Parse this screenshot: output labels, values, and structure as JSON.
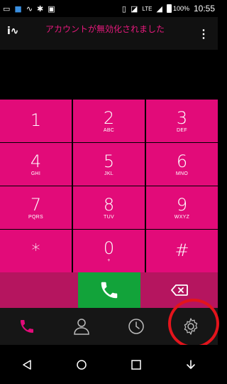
{
  "status_bar": {
    "left_icons": [
      "sim-icon",
      "notification-icon",
      "app-logo-icon",
      "android-icon",
      "photo-icon"
    ],
    "right_icons": [
      "vibrate-icon",
      "nfc-icon",
      "lte-icon",
      "signal-icon",
      "battery-icon"
    ],
    "network": "LTE",
    "battery": "100%",
    "time": "10:55"
  },
  "header": {
    "logo": "i∿",
    "title": "アカウントが無効化されました",
    "menu_label": "⋮"
  },
  "keypad": {
    "keys": [
      {
        "digit": "1",
        "letters": ""
      },
      {
        "digit": "2",
        "letters": "ABC"
      },
      {
        "digit": "3",
        "letters": "DEF"
      },
      {
        "digit": "4",
        "letters": "GHI"
      },
      {
        "digit": "5",
        "letters": "JKL"
      },
      {
        "digit": "6",
        "letters": "MNO"
      },
      {
        "digit": "7",
        "letters": "PQRS"
      },
      {
        "digit": "8",
        "letters": "TUV"
      },
      {
        "digit": "9",
        "letters": "WXYZ"
      },
      {
        "digit": "*",
        "letters": ""
      },
      {
        "digit": "0",
        "letters": "+"
      },
      {
        "digit": "#",
        "letters": ""
      }
    ]
  },
  "actions": {
    "call_icon": "phone-icon",
    "backspace_icon": "backspace-icon"
  },
  "tabs": [
    {
      "name": "dialer",
      "icon": "phone-icon",
      "active": true
    },
    {
      "name": "contacts",
      "icon": "person-icon",
      "active": false
    },
    {
      "name": "history",
      "icon": "clock-icon",
      "active": false
    },
    {
      "name": "settings",
      "icon": "gear-icon",
      "active": false
    }
  ],
  "nav": [
    "back-icon",
    "home-icon",
    "recents-icon",
    "download-icon"
  ],
  "colors": {
    "accent": "#e20b79",
    "action_row": "#b5155f",
    "call_green": "#12a33a",
    "highlight": "#e3141c",
    "tab_bar": "#161616"
  }
}
